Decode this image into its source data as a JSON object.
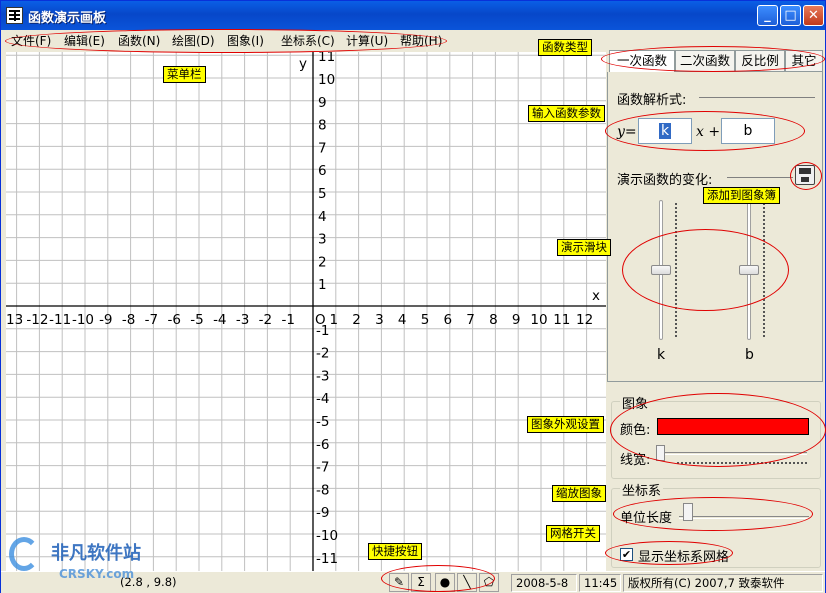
{
  "window": {
    "title": "函数演示画板"
  },
  "menu": [
    "文件(F)",
    "编辑(E)",
    "函数(N)",
    "绘图(D)",
    "图象(I)",
    "坐标系(C)",
    "计算(U)",
    "帮助(H)"
  ],
  "graph": {
    "x_ticks": [
      "13",
      "-12",
      "-11",
      "-10",
      "-9",
      "-8",
      "-7",
      "-6",
      "-5",
      "-4",
      "-3",
      "-2",
      "-1",
      "1",
      "2",
      "3",
      "4",
      "5",
      "6",
      "7",
      "8",
      "9",
      "10",
      "11",
      "12"
    ],
    "y_ticks_pos": [
      "11",
      "10",
      "9",
      "8",
      "7",
      "6",
      "5",
      "4",
      "3",
      "2",
      "1"
    ],
    "y_ticks_neg": [
      "-1",
      "-2",
      "-3",
      "-4",
      "-5",
      "-6",
      "-7",
      "-8",
      "-9",
      "-10",
      "-11"
    ],
    "x_axis_label": "x",
    "y_axis_label": "y",
    "origin_label": "O"
  },
  "tabs": [
    "一次函数",
    "二次函数",
    "反比例",
    "其它"
  ],
  "function_panel": {
    "expr_label": "函数解析式:",
    "y_eq": "y=",
    "k_value": "k",
    "x_plus": "x +",
    "b_value": "b",
    "demo_label": "演示函数的变化:",
    "slider_k_label": "k",
    "slider_b_label": "b",
    "slider_k_level": 0.5,
    "slider_b_level": 0.5
  },
  "image_group": {
    "title": "图象",
    "color_label": "颜色:",
    "color": "#ff0000",
    "width_label": "线宽:"
  },
  "coord_group": {
    "title": "坐标系",
    "unit_label": "单位长度",
    "show_grid_label": "显示坐标系网格",
    "show_grid": true
  },
  "statusbar": {
    "coords": "(2.8 , 9.8)",
    "date": "2008-5-8",
    "time": "11:45",
    "copyright": "版权所有(C) 2007,7 致泰软件"
  },
  "annotations": {
    "menubar": "菜单栏",
    "func_type": "函数类型",
    "input_params": "输入函数参数",
    "add_to_book": "添加到图象簿",
    "demo_slider": "演示滑块",
    "appearance": "图象外观设置",
    "zoom": "缩放图象",
    "grid_switch": "网格开关",
    "quick_buttons": "快捷按钮"
  },
  "watermark": {
    "main": "非凡软件站",
    "sub": "CRSKY.com"
  },
  "colors": {
    "title_bar": "#0747c9",
    "annotation_bg": "#ffff00",
    "annotation_outline": "#e00000",
    "grid_line": "#c0c0c0"
  }
}
